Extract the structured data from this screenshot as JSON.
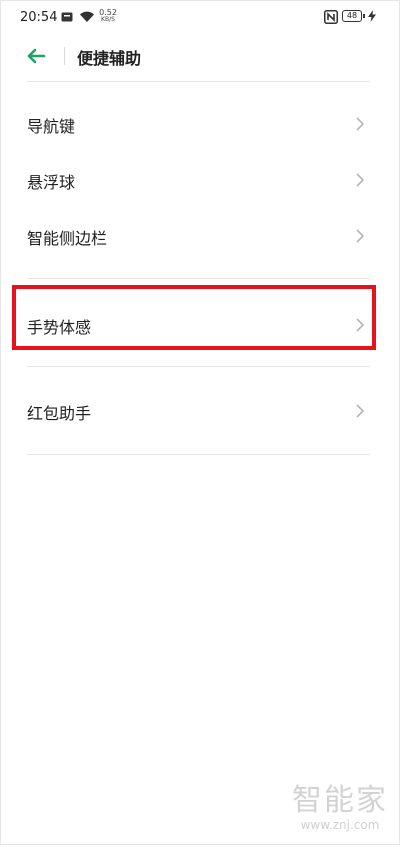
{
  "status_bar": {
    "time": "20:54",
    "net_speed_value": "0.52",
    "net_speed_unit": "KB/S",
    "battery_level": "48",
    "icons": [
      "message-icon",
      "wifi-icon",
      "nfc-icon",
      "battery-icon",
      "charging-icon"
    ]
  },
  "header": {
    "title": "便捷辅助",
    "back_icon": "arrow-left-icon"
  },
  "menu": {
    "items": [
      {
        "label": "导航键"
      },
      {
        "label": "悬浮球"
      },
      {
        "label": "智能侧边栏"
      },
      {
        "label": "手势体感"
      },
      {
        "label": "红包助手"
      }
    ]
  },
  "highlight": {
    "target": "手势体感",
    "color": "#e8121c"
  },
  "watermark": {
    "logo_text": "智能家",
    "url": "www.znj.com"
  },
  "colors": {
    "accent": "#1aa36b",
    "chevron": "#b5b5b5",
    "divider": "#e5e5e5"
  }
}
